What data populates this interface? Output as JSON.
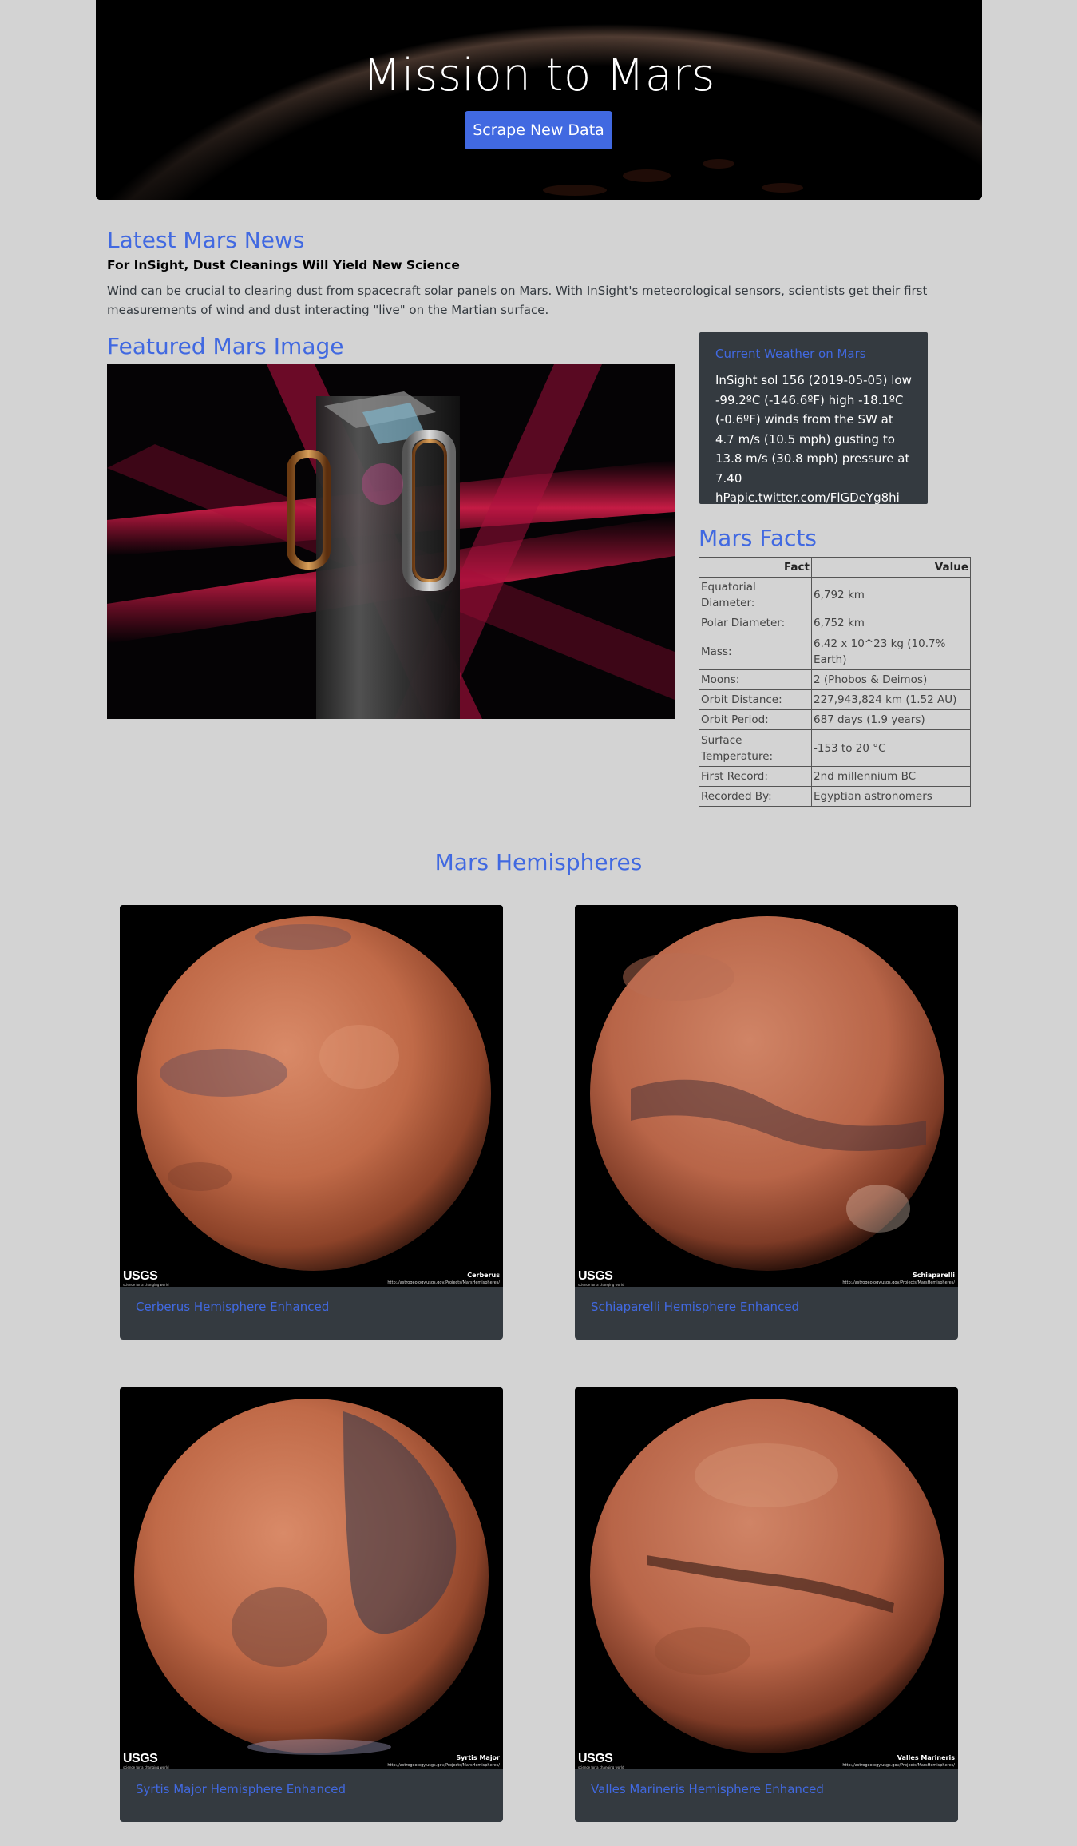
{
  "jumbotron": {
    "title": "Mission to Mars",
    "button_label": "Scrape New Data"
  },
  "news": {
    "heading": "Latest Mars News",
    "title": "For InSight, Dust Cleanings Will Yield New Science",
    "paragraph": "Wind can be crucial to clearing dust from spacecraft solar panels on Mars. With InSight's meteorological sensors, scientists get their first measurements of wind and dust interacting \"live\" on the Martian surface."
  },
  "featured": {
    "heading": "Featured Mars Image"
  },
  "weather": {
    "heading": "Current Weather on Mars",
    "text": "InSight sol 156 (2019-05-05) low -99.2ºC (-146.6ºF) high -18.1ºC (-0.6ºF) winds from the SW at 4.7 m/s (10.5 mph) gusting to 13.8 m/s (30.8 mph) pressure at 7.40 hPapic.twitter.com/FlGDeYg8hi"
  },
  "facts": {
    "heading": "Mars Facts",
    "col_fact": "Fact",
    "col_value": "Value",
    "rows": [
      {
        "fact": "Equatorial Diameter:",
        "value": "6,792 km"
      },
      {
        "fact": "Polar Diameter:",
        "value": "6,752 km"
      },
      {
        "fact": "Mass:",
        "value": "6.42 x 10^23 kg (10.7% Earth)"
      },
      {
        "fact": "Moons:",
        "value": "2 (Phobos & Deimos)"
      },
      {
        "fact": "Orbit Distance:",
        "value": "227,943,824 km (1.52 AU)"
      },
      {
        "fact": "Orbit Period:",
        "value": "687 days (1.9 years)"
      },
      {
        "fact": "Surface Temperature:",
        "value": "-153 to 20 °C"
      },
      {
        "fact": "First Record:",
        "value": "2nd millennium BC"
      },
      {
        "fact": "Recorded By:",
        "value": "Egyptian astronomers"
      }
    ]
  },
  "hemispheres": {
    "heading": "Mars Hemispheres",
    "logo_text": "USGS",
    "logo_sub": "science for a changing world",
    "image_url_text": "http://astrogeology.usgs.gov/Projects/MarsHemispheres/",
    "items": [
      {
        "title": "Cerberus Hemisphere Enhanced",
        "image_label": "Cerberus"
      },
      {
        "title": "Schiaparelli Hemisphere Enhanced",
        "image_label": "Schiaparelli"
      },
      {
        "title": "Syrtis Major Hemisphere Enhanced",
        "image_label": "Syrtis Major"
      },
      {
        "title": "Valles Marineris Hemisphere Enhanced",
        "image_label": "Valles Marineris"
      }
    ]
  },
  "colors": {
    "background": "#d3d3d3",
    "accent": "#4169e1",
    "panel": "#343a40"
  }
}
